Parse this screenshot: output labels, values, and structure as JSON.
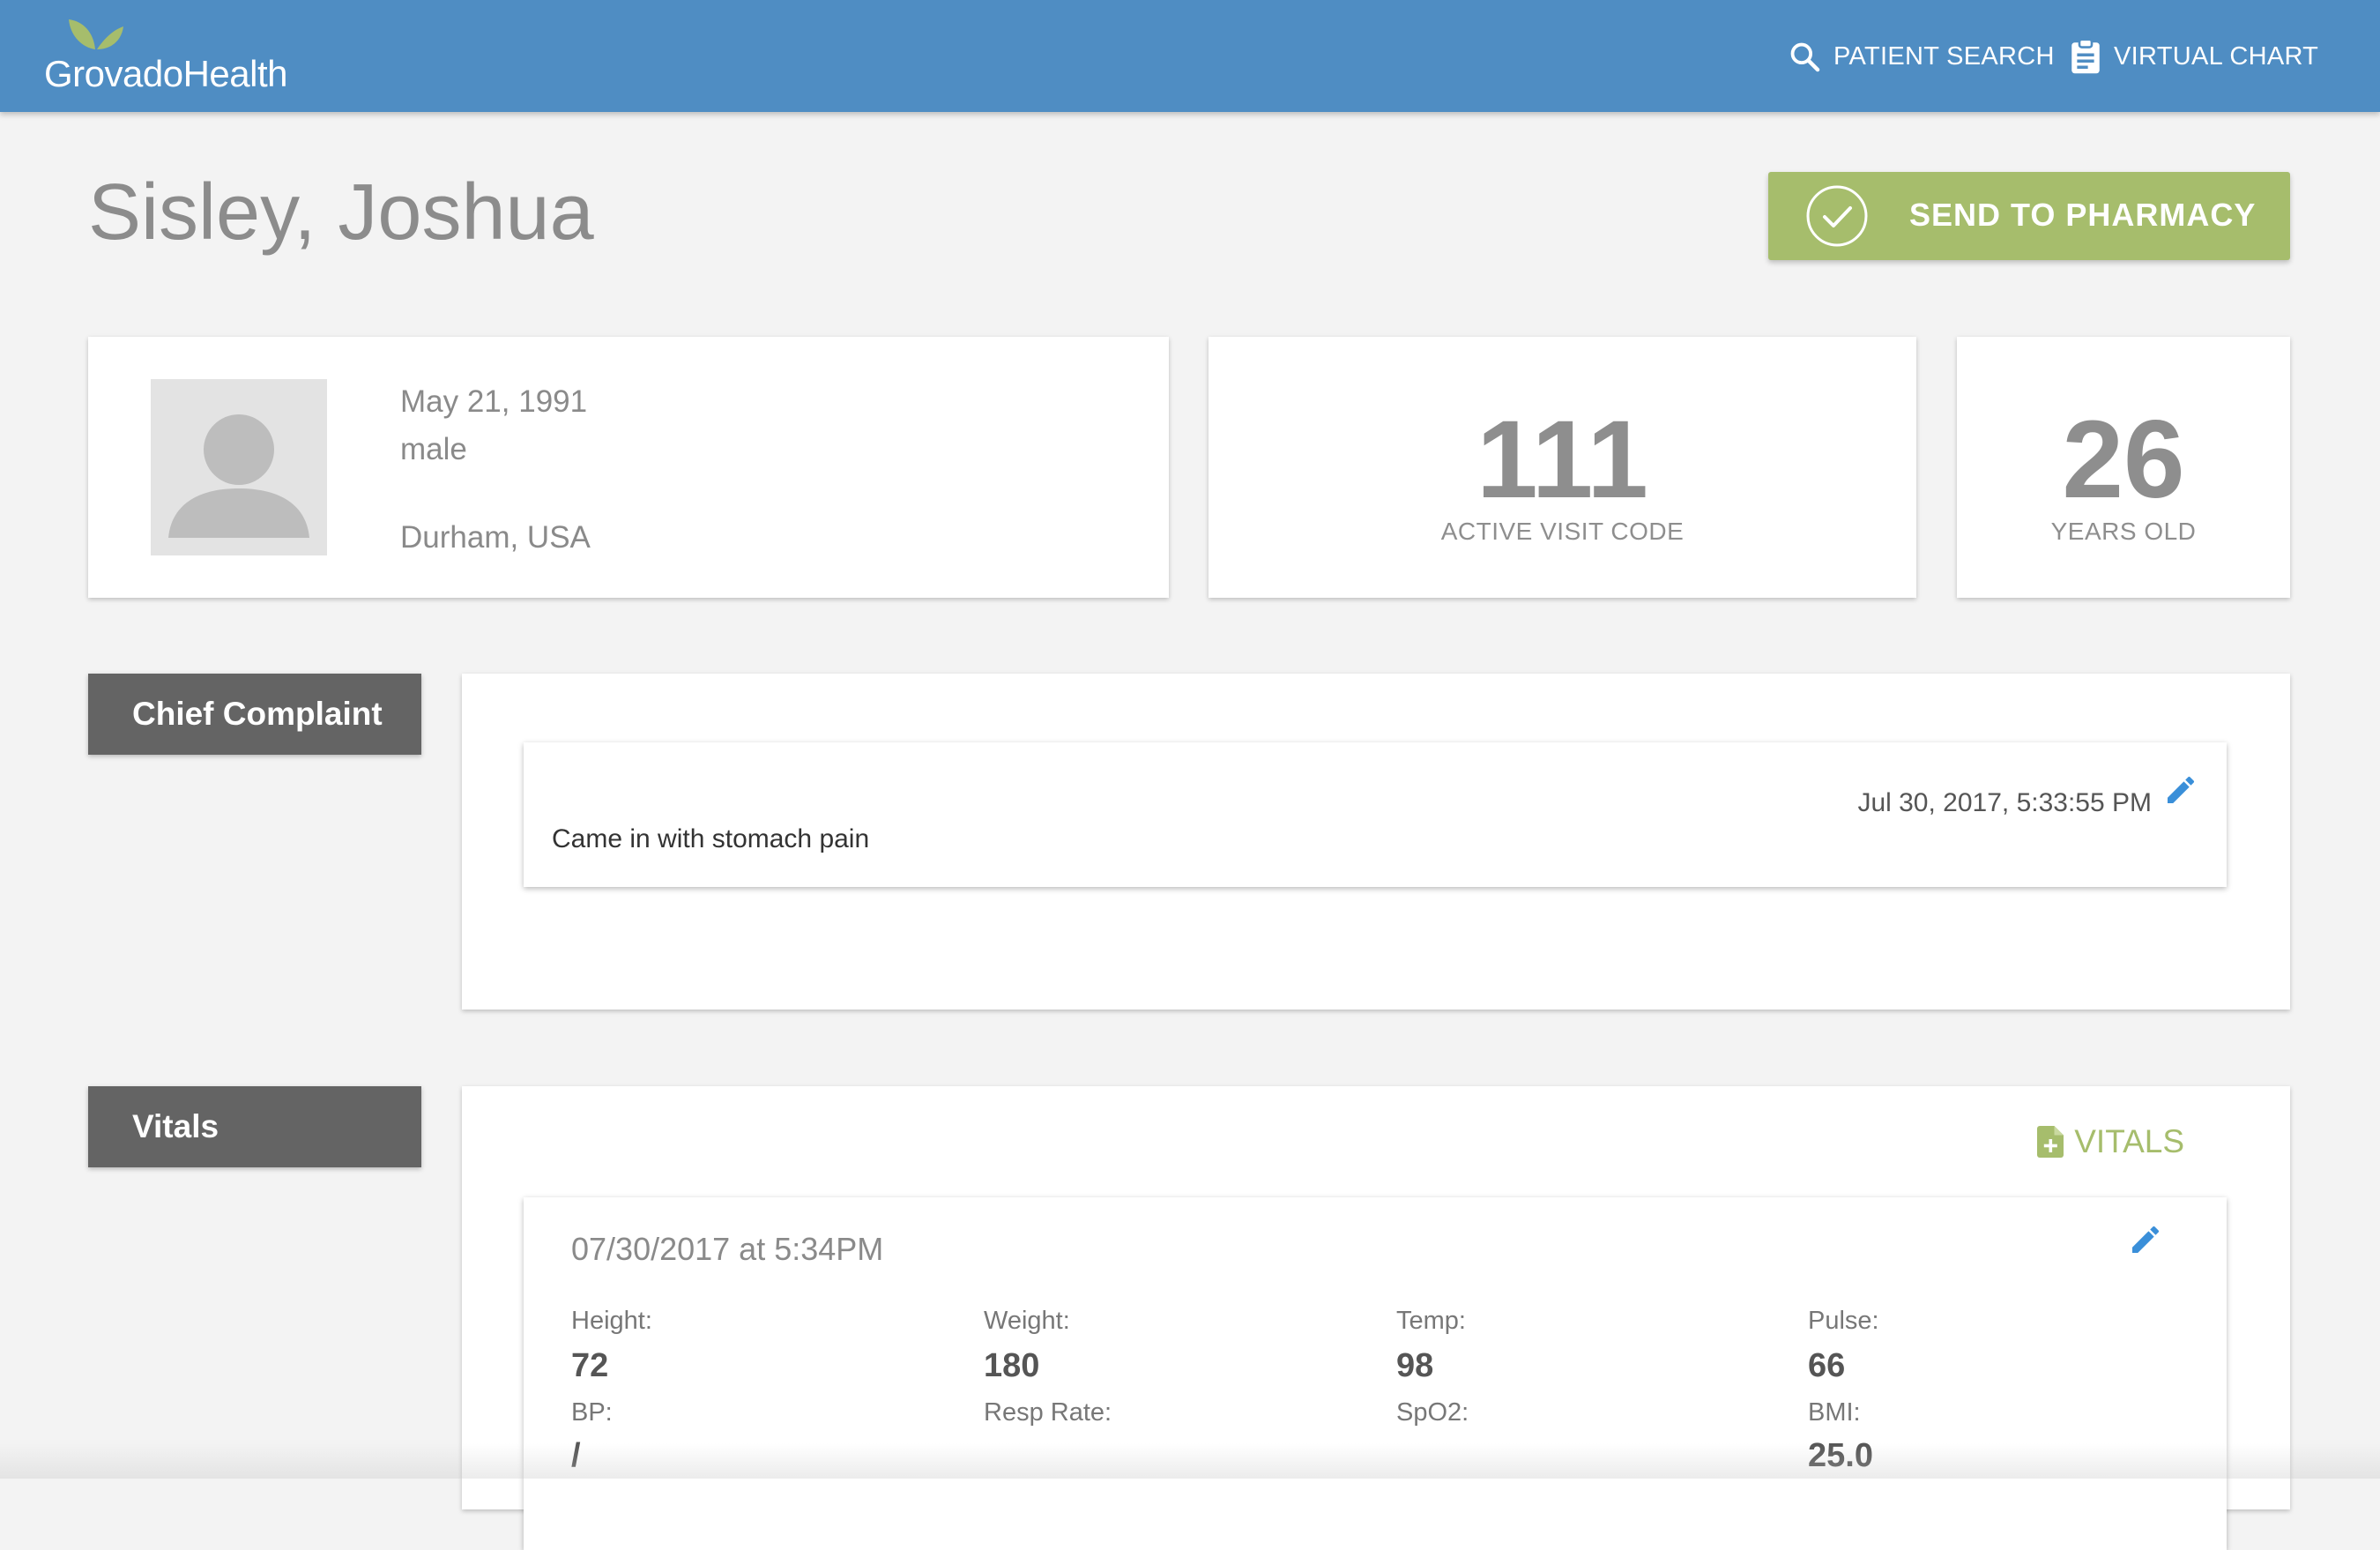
{
  "header": {
    "brand": "GrovadoHealth",
    "nav": [
      {
        "label": "PATIENT SEARCH",
        "icon": "search-icon"
      },
      {
        "label": "VIRTUAL CHART",
        "icon": "clipboard-icon"
      }
    ]
  },
  "patient": {
    "name": "Sisley, Joshua",
    "dob": "May 21, 1991",
    "sex": "male",
    "location": "Durham, USA",
    "visit_code": "111",
    "visit_code_label": "ACTIVE VISIT CODE",
    "age": "26",
    "age_label": "YEARS OLD"
  },
  "actions": {
    "send_to_pharmacy": "SEND TO PHARMACY"
  },
  "chief_complaint": {
    "section_label": "Chief Complaint",
    "timestamp": "Jul 30, 2017, 5:33:55 PM",
    "text": "Came in with stomach pain"
  },
  "vitals": {
    "section_label": "Vitals",
    "add_label": "VITALS",
    "entry": {
      "date": "07/30/2017 at 5:34PM",
      "items": [
        {
          "label": "Height:",
          "value": "72"
        },
        {
          "label": "Weight:",
          "value": "180"
        },
        {
          "label": "Temp:",
          "value": "98"
        },
        {
          "label": "Pulse:",
          "value": "66"
        },
        {
          "label": "BP:",
          "value": "/"
        },
        {
          "label": "Resp Rate:",
          "value": ""
        },
        {
          "label": "SpO2:",
          "value": ""
        },
        {
          "label": "BMI:",
          "value": "25.0"
        }
      ]
    }
  },
  "colors": {
    "header": "#4f8dc3",
    "accent_green": "#a6bd6c",
    "section_button": "#646464",
    "edit_blue": "#3a8fd9",
    "background": "#f3f3f3"
  }
}
